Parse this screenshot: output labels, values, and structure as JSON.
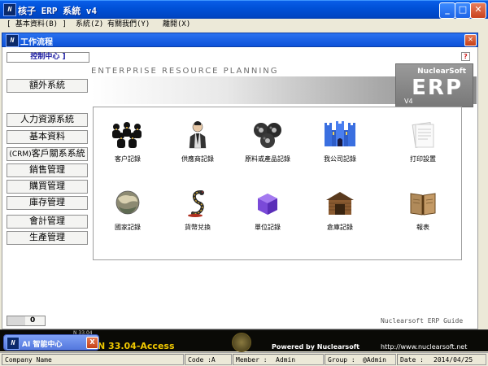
{
  "window": {
    "title": "核子 ERP 系統 v4",
    "app_icon_text": "N"
  },
  "menu": {
    "items": [
      "[ 基本資料(B) ]",
      "系統(Z)",
      "有關我們(Y)",
      "離開(X)"
    ]
  },
  "child_window": {
    "title": "工作流程"
  },
  "control_center": {
    "label": "控制中心 ]"
  },
  "help_label": "?",
  "banner": {
    "title": "ENTERPRISE RESOURCE PLANNING",
    "brand": "NuclearSoft",
    "product": "ERP",
    "version": "V4"
  },
  "sidebar": {
    "extra_system": "額外系統",
    "items": [
      {
        "label": "人力資源系統"
      },
      {
        "label": "基本資料"
      },
      {
        "prefix": "(CRM)",
        "label": "客戶關系系統"
      },
      {
        "label": "銷售管理"
      },
      {
        "label": "購買管理"
      },
      {
        "label": "庫存管理"
      },
      {
        "label": "會計管理"
      },
      {
        "label": "生產管理"
      }
    ]
  },
  "modules": [
    {
      "label": "客户記錄",
      "icon": "people-group-icon"
    },
    {
      "label": "供應商記錄",
      "icon": "person-suit-icon"
    },
    {
      "label": "原料或產品記錄",
      "icon": "film-reels-icon"
    },
    {
      "label": "我公司記錄",
      "icon": "castle-icon"
    },
    {
      "label": "打印設置",
      "icon": "document-print-icon"
    },
    {
      "label": "國家記錄",
      "icon": "globe-icon"
    },
    {
      "label": "貨幣兌換",
      "icon": "snake-currency-icon"
    },
    {
      "label": "單位記錄",
      "icon": "cube-icon"
    },
    {
      "label": "倉庫記錄",
      "icon": "warehouse-icon"
    },
    {
      "label": "報表",
      "icon": "book-report-icon"
    }
  ],
  "zoom": {
    "value": "0"
  },
  "footer_guide": "Nuclearsoft ERP Guide",
  "bottom_banner": {
    "version_small": "N 33.04",
    "version_text": "N 33.04-Access",
    "powered_by": "Powered by Nuclearsoft",
    "url": "http://www.nuclearsoft.net"
  },
  "ai_popup": {
    "label": "AI 智能中心",
    "close": "X"
  },
  "status_bar": {
    "company": "Company Name",
    "code": "Code :A",
    "member_label": "Member :",
    "member_value": "Admin",
    "group_label": "Group :",
    "group_value": "@Admin",
    "date_label": "Date :",
    "date_value": "2014/04/25"
  },
  "colors": {
    "titlebar": "#0051D8",
    "bottom_text": "#F0C800",
    "control_center_text": "#1A1AA0"
  }
}
